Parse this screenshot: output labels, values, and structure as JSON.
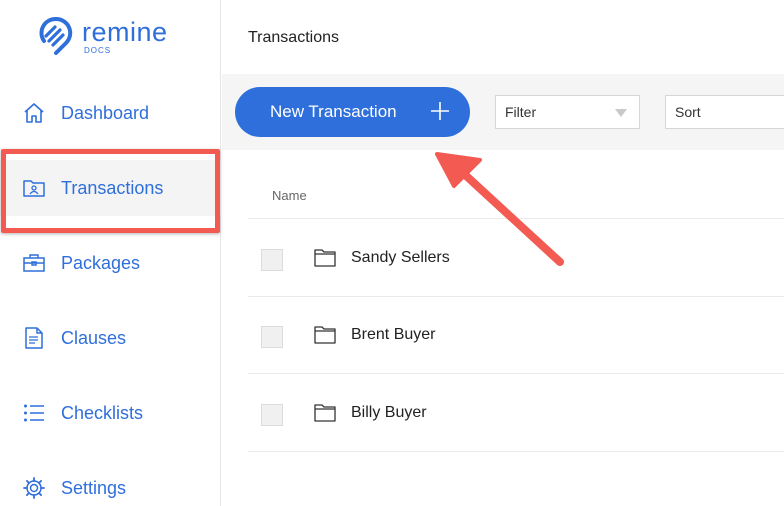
{
  "brand": {
    "name": "remine",
    "sub": "DOCS",
    "color": "#2f6fdb"
  },
  "sidebar": {
    "items": [
      {
        "label": "Dashboard",
        "icon": "home-icon"
      },
      {
        "label": "Transactions",
        "icon": "folder-user-icon",
        "active": true
      },
      {
        "label": "Packages",
        "icon": "briefcase-icon"
      },
      {
        "label": "Clauses",
        "icon": "document-icon"
      },
      {
        "label": "Checklists",
        "icon": "list-icon"
      },
      {
        "label": "Settings",
        "icon": "gear-icon"
      }
    ]
  },
  "header": {
    "title": "Transactions"
  },
  "toolbar": {
    "new_label": "New Transaction",
    "filter_label": "Filter",
    "sort_label": "Sort"
  },
  "table": {
    "columns": [
      "Name"
    ],
    "rows": [
      {
        "name": "Sandy Sellers"
      },
      {
        "name": "Brent Buyer"
      },
      {
        "name": "Billy Buyer"
      }
    ]
  },
  "annotation": {
    "highlight_color": "#f25a52"
  }
}
